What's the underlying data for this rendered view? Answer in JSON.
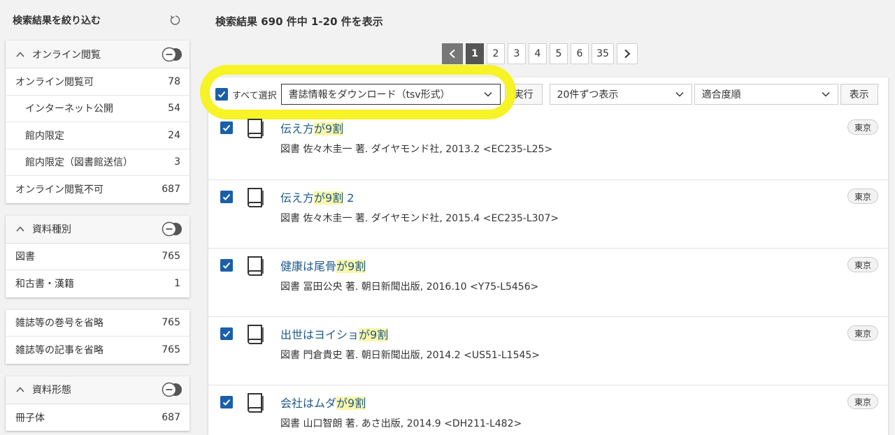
{
  "sidebar": {
    "title": "検索結果を絞り込む",
    "facets": [
      {
        "title": "オンライン閲覧",
        "rows": [
          {
            "label": "オンライン閲覧可",
            "count": "78",
            "indent": false
          },
          {
            "label": "インターネット公開",
            "count": "54",
            "indent": true
          },
          {
            "label": "館内限定",
            "count": "24",
            "indent": true
          },
          {
            "label": "館内限定（図書館送信）",
            "count": "3",
            "indent": true
          },
          {
            "label": "オンライン閲覧不可",
            "count": "687",
            "indent": false
          }
        ]
      },
      {
        "title": "資料種別",
        "rows": [
          {
            "label": "図書",
            "count": "765"
          },
          {
            "label": "和古書・漢籍",
            "count": "1"
          }
        ]
      },
      {
        "rows": [
          {
            "label": "雑誌等の巻号を省略",
            "count": "765"
          },
          {
            "label": "雑誌等の記事を省略",
            "count": "765"
          }
        ]
      },
      {
        "title": "資料形態",
        "rows": [
          {
            "label": "冊子体",
            "count": "687"
          }
        ]
      }
    ]
  },
  "summary": "検索結果 690 件中 1-20 件を表示",
  "pager": {
    "pages": [
      "1",
      "2",
      "3",
      "4",
      "5",
      "6",
      "35"
    ],
    "current": "1"
  },
  "toolbar": {
    "select_all_label": "すべて選択",
    "download_option": "書誌情報をダウンロード（tsv形式）",
    "run_label": "実行",
    "per_page": "20件ずつ表示",
    "sort": "適合度順",
    "show_label": "表示"
  },
  "colors": {
    "highlight_ring": "#f5f21a",
    "link": "#1c5a8c",
    "checkbox": "#1a5fa8",
    "current_page": "#555555"
  },
  "results": [
    {
      "title_pre": "伝え方",
      "title_hl1": "が",
      "title_hl2": "9割",
      "title_post": "",
      "meta": "図書 佐々木圭一 著. ダイヤモンド社, 2013.2 <EC235-L25>",
      "location": "東京"
    },
    {
      "title_pre": "伝え方",
      "title_hl1": "が",
      "title_hl2": "9割",
      "title_post": " 2",
      "meta": "図書 佐々木圭一 著. ダイヤモンド社, 2015.4 <EC235-L307>",
      "location": "東京"
    },
    {
      "title_pre": "健康は尾骨",
      "title_hl1": "が",
      "title_hl2": "9割",
      "title_post": "",
      "meta": "図書 冨田公央 著. 朝日新聞出版, 2016.10 <Y75-L5456>",
      "location": "東京"
    },
    {
      "title_pre": "出世はヨイショ",
      "title_hl1": "が",
      "title_hl2": "9割",
      "title_post": "",
      "meta": "図書 門倉貴史 著. 朝日新聞出版, 2014.2 <US51-L1545>",
      "location": "東京"
    },
    {
      "title_pre": "会社はムダ",
      "title_hl1": "が",
      "title_hl2": "9割",
      "title_post": "",
      "meta": "図書 山口智朗 著. あさ出版, 2014.9 <DH211-L482>",
      "location": "東京"
    }
  ]
}
